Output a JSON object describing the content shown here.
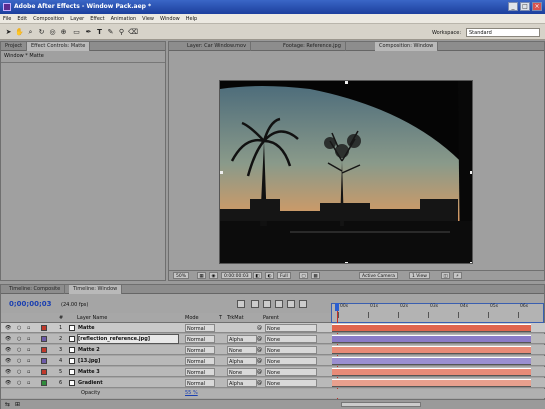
{
  "window": {
    "title": "Adobe After Effects - Window Pack.aep *"
  },
  "menu": [
    "File",
    "Edit",
    "Composition",
    "Layer",
    "Effect",
    "Animation",
    "View",
    "Window",
    "Help"
  ],
  "workspace": {
    "label": "Workspace:",
    "value": "Standard"
  },
  "left_panel": {
    "tabs": [
      "Project",
      "Effect Controls: Matte"
    ],
    "breadcrumb": "Window * Matte"
  },
  "viewer": {
    "tabs": [
      "Layer: Car Window.mov",
      "Footage: Reference.jpg",
      "Composition: Window"
    ],
    "zoom": "50%",
    "timecode": "0:00:00:03",
    "resolution": "Full",
    "camera": "Active Camera",
    "views": "1 View"
  },
  "timeline": {
    "tabs": [
      "Timeline: Composite",
      "Timeline: Window"
    ],
    "current_time": "0;00;00;03",
    "fps": "(24.00 fps)",
    "column_headers": {
      "num": "#",
      "layer_name": "Layer Name",
      "mode": "Mode",
      "t": "T",
      "trkmat": "TrkMat",
      "parent": "Parent"
    },
    "ruler_labels": [
      "00s",
      "01s",
      "02s",
      "03s",
      "04s",
      "05s",
      "06s"
    ],
    "layers": [
      {
        "num": "1",
        "name": "Matte",
        "mode": "Normal",
        "trkmat": "",
        "parent": "None",
        "color": "#c0392b",
        "bar": "#e0654e"
      },
      {
        "num": "2",
        "name": "[reflection_reference.jpg]",
        "mode": "Normal",
        "trkmat": "Alpha",
        "parent": "None",
        "color": "#6c5aa8",
        "bar": "#8a7bc8"
      },
      {
        "num": "3",
        "name": "Matte 2",
        "mode": "Normal",
        "trkmat": "None",
        "parent": "None",
        "color": "#c0392b",
        "bar": "#e88b78"
      },
      {
        "num": "4",
        "name": "[13.jpg]",
        "mode": "Normal",
        "trkmat": "Alpha",
        "parent": "None",
        "color": "#6c5aa8",
        "bar": "#9b8fd0"
      },
      {
        "num": "5",
        "name": "Matte 3",
        "mode": "Normal",
        "trkmat": "None",
        "parent": "None",
        "color": "#c0392b",
        "bar": "#e88b78"
      },
      {
        "num": "6",
        "name": "Gradient",
        "mode": "Normal",
        "trkmat": "Alpha",
        "parent": "None",
        "color": "#2e8b3a",
        "bar": "#e8a08e"
      }
    ],
    "opacity_label": "Opacity",
    "opacity_value": "55 %"
  }
}
